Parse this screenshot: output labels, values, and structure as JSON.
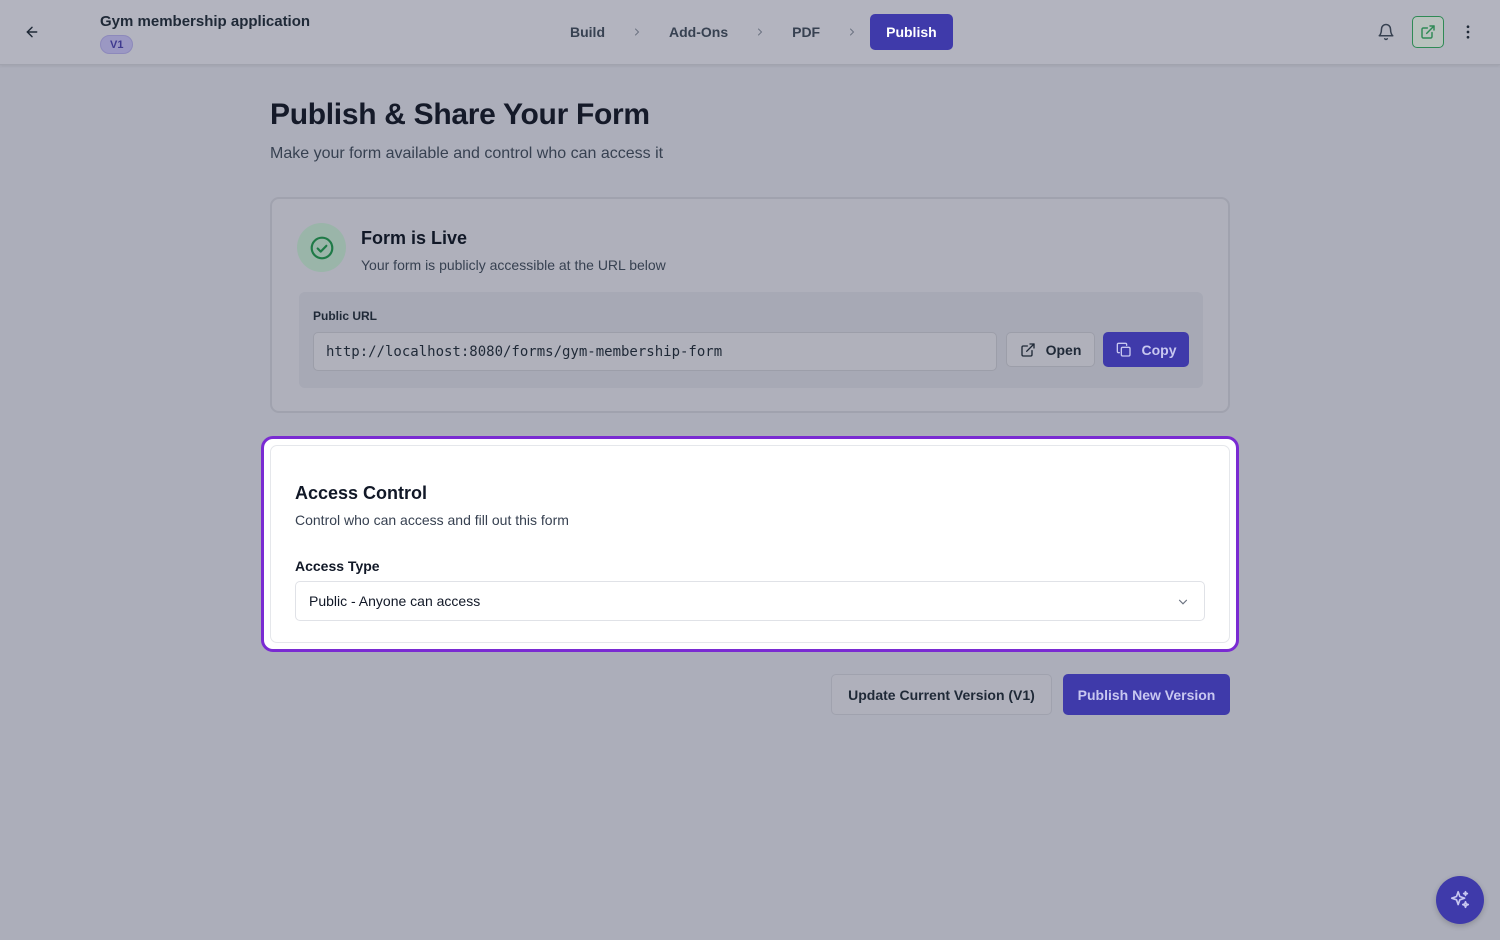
{
  "header": {
    "title": "Gym membership application",
    "version_badge": "V1",
    "back_icon": "arrow-left-icon",
    "steps": [
      {
        "label": "Build",
        "active": false
      },
      {
        "label": "Add-Ons",
        "active": false
      },
      {
        "label": "PDF",
        "active": false
      },
      {
        "label": "Publish",
        "active": true
      }
    ],
    "right_icons": [
      "bell-icon",
      "external-link-icon",
      "more-vertical-icon"
    ]
  },
  "page": {
    "heading": "Publish & Share Your Form",
    "subheading": "Make your form available and control who can access it"
  },
  "live_card": {
    "status_icon": "check-circle-icon",
    "title": "Form is Live",
    "description": "Your form is publicly accessible at the URL below",
    "url_label": "Public URL",
    "url_value": "http://localhost:8080/forms/gym-membership-form",
    "open_label": "Open",
    "copy_label": "Copy"
  },
  "access_control": {
    "title": "Access Control",
    "description": "Control who can access and fill out this form",
    "type_label": "Access Type",
    "selected_value": "Public - Anyone can access"
  },
  "actions": {
    "update_label": "Update Current Version (V1)",
    "publish_label": "Publish New Version"
  },
  "fab": {
    "icon": "sparkles-icon"
  },
  "colors": {
    "accent": "#3f3aaa",
    "highlight_border": "#7a2bd2",
    "success": "#2f8a55"
  }
}
